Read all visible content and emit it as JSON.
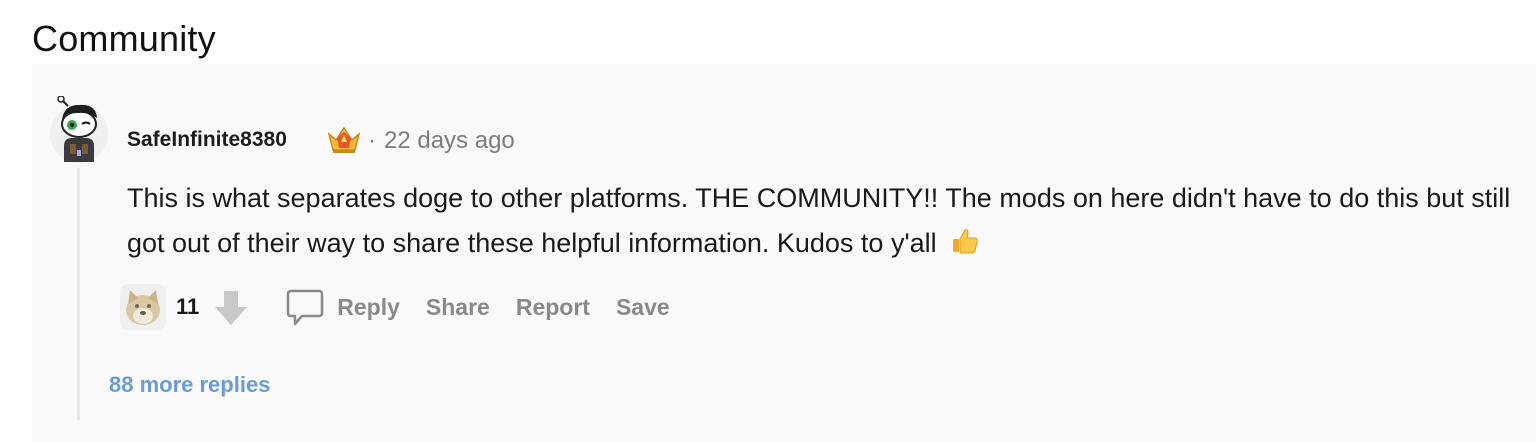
{
  "section": {
    "title": "Community"
  },
  "comment": {
    "author": "SafeInfinite8380",
    "separator": "·",
    "timestamp": "22 days ago",
    "body": "This is what separates doge to other platforms. THE COMMUNITY!! The mods on here didn't have to do this but still got out of their way to share these helpful information. Kudos to y'all",
    "body_emoji_icon": "thumbs-up-icon",
    "author_badge_icon": "award-crown-icon",
    "vote_count": "11",
    "actions": {
      "reply": "Reply",
      "share": "Share",
      "report": "Report",
      "save": "Save"
    },
    "more_replies": "88 more replies"
  },
  "colors": {
    "panel_background": "#f9f9fa",
    "action_text": "#878a8c",
    "link": "#6b9bd6",
    "thread_line": "#e4e5e7"
  }
}
